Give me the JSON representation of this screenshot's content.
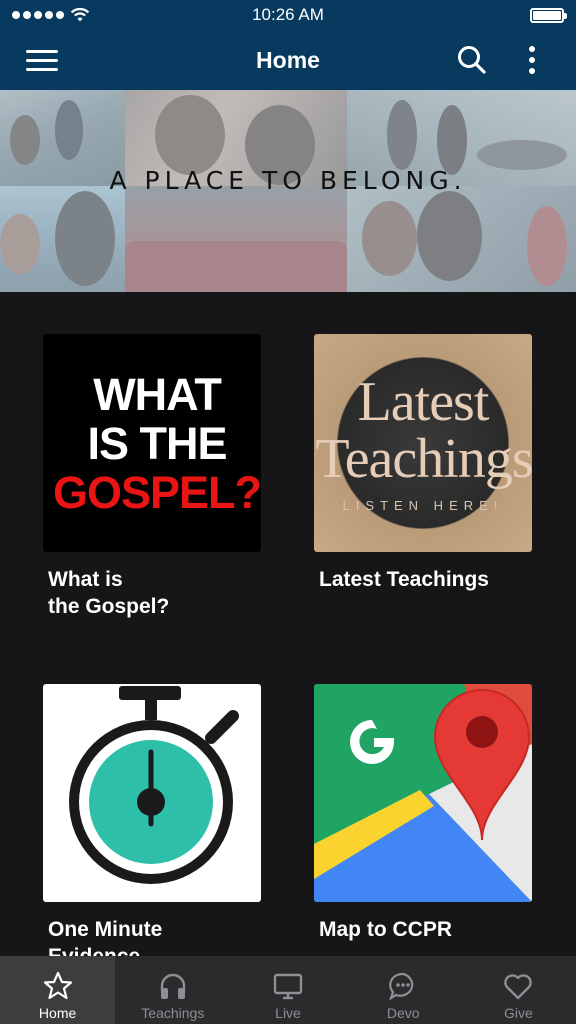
{
  "status_bar": {
    "time": "10:26 AM"
  },
  "header": {
    "title": "Home"
  },
  "banner": {
    "text": "A PLACE TO BELONG."
  },
  "tiles": [
    {
      "label": "What is\nthe Gospel?",
      "image_text": [
        "WHAT",
        "IS THE",
        "GOSPEL?"
      ]
    },
    {
      "label": "Latest Teachings",
      "image_text": [
        "Latest",
        "Teachings",
        "LISTEN HERE!"
      ]
    },
    {
      "label": "One Minute\nEvidence",
      "image_icon": "stopwatch-icon"
    },
    {
      "label": "Map to CCPR",
      "image_icon": "google-maps-icon"
    }
  ],
  "tabbar": {
    "items": [
      {
        "label": "Home",
        "icon": "star-icon",
        "active": true
      },
      {
        "label": "Teachings",
        "icon": "headphones-icon",
        "active": false
      },
      {
        "label": "Live",
        "icon": "tv-icon",
        "active": false
      },
      {
        "label": "Devo",
        "icon": "chat-bubble-icon",
        "active": false
      },
      {
        "label": "Give",
        "icon": "heart-icon",
        "active": false
      }
    ]
  },
  "colors": {
    "header_bg": "#073a5e",
    "body_bg": "#161618",
    "tabbar_bg": "#2b2b2d",
    "gospel_red": "#e91515"
  }
}
